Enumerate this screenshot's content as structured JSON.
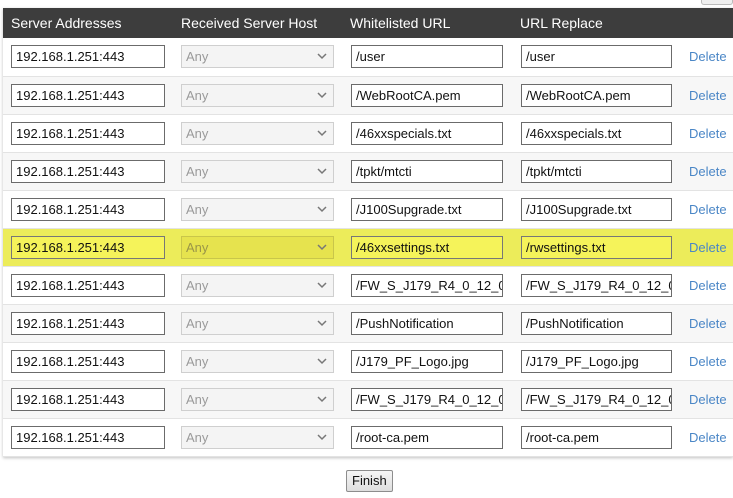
{
  "table": {
    "headers": {
      "server": "Server Addresses",
      "host": "Received Server Host",
      "url": "Whitelisted URL",
      "replace": "URL Replace"
    },
    "rows": [
      {
        "server": "192.168.1.251:443",
        "host": "Any",
        "url": "/user",
        "replace": "/user",
        "action": "Delete",
        "highlighted": false
      },
      {
        "server": "192.168.1.251:443",
        "host": "Any",
        "url": "/WebRootCA.pem",
        "replace": "/WebRootCA.pem",
        "action": "Delete",
        "highlighted": false
      },
      {
        "server": "192.168.1.251:443",
        "host": "Any",
        "url": "/46xxspecials.txt",
        "replace": "/46xxspecials.txt",
        "action": "Delete",
        "highlighted": false
      },
      {
        "server": "192.168.1.251:443",
        "host": "Any",
        "url": "/tpkt/mtcti",
        "replace": "/tpkt/mtcti",
        "action": "Delete",
        "highlighted": false
      },
      {
        "server": "192.168.1.251:443",
        "host": "Any",
        "url": "/J100Supgrade.txt",
        "replace": "/J100Supgrade.txt",
        "action": "Delete",
        "highlighted": false
      },
      {
        "server": "192.168.1.251:443",
        "host": "Any",
        "url": "/46xxsettings.txt",
        "replace": "/rwsettings.txt",
        "action": "Delete",
        "highlighted": true
      },
      {
        "server": "192.168.1.251:443",
        "host": "Any",
        "url": "/FW_S_J179_R4_0_12_0_",
        "replace": "/FW_S_J179_R4_0_12_0_",
        "action": "Delete",
        "highlighted": false
      },
      {
        "server": "192.168.1.251:443",
        "host": "Any",
        "url": "/PushNotification",
        "replace": "/PushNotification",
        "action": "Delete",
        "highlighted": false
      },
      {
        "server": "192.168.1.251:443",
        "host": "Any",
        "url": "/J179_PF_Logo.jpg",
        "replace": "/J179_PF_Logo.jpg",
        "action": "Delete",
        "highlighted": false
      },
      {
        "server": "192.168.1.251:443",
        "host": "Any",
        "url": "/FW_S_J179_R4_0_12_0_",
        "replace": "/FW_S_J179_R4_0_12_0_",
        "action": "Delete",
        "highlighted": false
      },
      {
        "server": "192.168.1.251:443",
        "host": "Any",
        "url": "/root-ca.pem",
        "replace": "/root-ca.pem",
        "action": "Delete",
        "highlighted": false
      }
    ]
  },
  "footer": {
    "finish_label": "Finish"
  },
  "colors": {
    "header_bg": "#3d3d3d",
    "highlight": "#ecec5a",
    "link": "#4a86c6"
  },
  "icons": {
    "select_arrow": "chevron-down-icon"
  }
}
